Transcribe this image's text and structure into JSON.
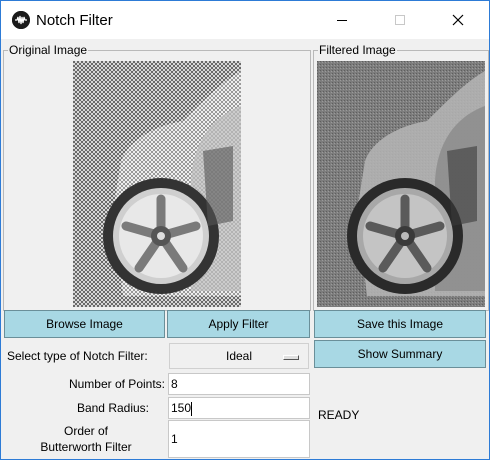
{
  "window": {
    "title": "Notch Filter",
    "min_symbol": "—",
    "max_symbol": "☐",
    "close_symbol": "✕"
  },
  "left_panel": {
    "legend": "Original Image"
  },
  "right_panel": {
    "legend": "Filtered Image"
  },
  "buttons": {
    "browse": "Browse Image",
    "apply": "Apply Filter",
    "save": "Save this Image",
    "summary": "Show Summary"
  },
  "filter_type": {
    "label": "Select type of Notch Filter:",
    "value": "Ideal"
  },
  "points": {
    "label": "Number of Points:",
    "value": "8"
  },
  "radius": {
    "label": "Band Radius:",
    "value": "150"
  },
  "order": {
    "label_line1": "Order of",
    "label_line2": "Butterworth Filter",
    "value": "1"
  },
  "status": "READY",
  "colors": {
    "button_bg": "#a8d8e4",
    "window_bg": "#f0f0f0"
  }
}
